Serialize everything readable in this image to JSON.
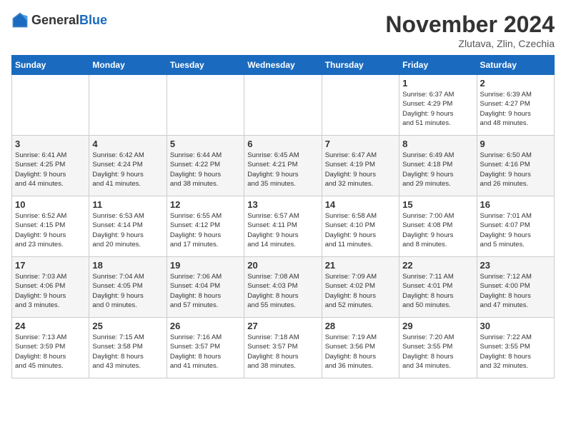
{
  "logo": {
    "general": "General",
    "blue": "Blue"
  },
  "title": "November 2024",
  "subtitle": "Zlutava, Zlin, Czechia",
  "days_of_week": [
    "Sunday",
    "Monday",
    "Tuesday",
    "Wednesday",
    "Thursday",
    "Friday",
    "Saturday"
  ],
  "weeks": [
    [
      {
        "day": "",
        "info": ""
      },
      {
        "day": "",
        "info": ""
      },
      {
        "day": "",
        "info": ""
      },
      {
        "day": "",
        "info": ""
      },
      {
        "day": "",
        "info": ""
      },
      {
        "day": "1",
        "info": "Sunrise: 6:37 AM\nSunset: 4:29 PM\nDaylight: 9 hours\nand 51 minutes."
      },
      {
        "day": "2",
        "info": "Sunrise: 6:39 AM\nSunset: 4:27 PM\nDaylight: 9 hours\nand 48 minutes."
      }
    ],
    [
      {
        "day": "3",
        "info": "Sunrise: 6:41 AM\nSunset: 4:25 PM\nDaylight: 9 hours\nand 44 minutes."
      },
      {
        "day": "4",
        "info": "Sunrise: 6:42 AM\nSunset: 4:24 PM\nDaylight: 9 hours\nand 41 minutes."
      },
      {
        "day": "5",
        "info": "Sunrise: 6:44 AM\nSunset: 4:22 PM\nDaylight: 9 hours\nand 38 minutes."
      },
      {
        "day": "6",
        "info": "Sunrise: 6:45 AM\nSunset: 4:21 PM\nDaylight: 9 hours\nand 35 minutes."
      },
      {
        "day": "7",
        "info": "Sunrise: 6:47 AM\nSunset: 4:19 PM\nDaylight: 9 hours\nand 32 minutes."
      },
      {
        "day": "8",
        "info": "Sunrise: 6:49 AM\nSunset: 4:18 PM\nDaylight: 9 hours\nand 29 minutes."
      },
      {
        "day": "9",
        "info": "Sunrise: 6:50 AM\nSunset: 4:16 PM\nDaylight: 9 hours\nand 26 minutes."
      }
    ],
    [
      {
        "day": "10",
        "info": "Sunrise: 6:52 AM\nSunset: 4:15 PM\nDaylight: 9 hours\nand 23 minutes."
      },
      {
        "day": "11",
        "info": "Sunrise: 6:53 AM\nSunset: 4:14 PM\nDaylight: 9 hours\nand 20 minutes."
      },
      {
        "day": "12",
        "info": "Sunrise: 6:55 AM\nSunset: 4:12 PM\nDaylight: 9 hours\nand 17 minutes."
      },
      {
        "day": "13",
        "info": "Sunrise: 6:57 AM\nSunset: 4:11 PM\nDaylight: 9 hours\nand 14 minutes."
      },
      {
        "day": "14",
        "info": "Sunrise: 6:58 AM\nSunset: 4:10 PM\nDaylight: 9 hours\nand 11 minutes."
      },
      {
        "day": "15",
        "info": "Sunrise: 7:00 AM\nSunset: 4:08 PM\nDaylight: 9 hours\nand 8 minutes."
      },
      {
        "day": "16",
        "info": "Sunrise: 7:01 AM\nSunset: 4:07 PM\nDaylight: 9 hours\nand 5 minutes."
      }
    ],
    [
      {
        "day": "17",
        "info": "Sunrise: 7:03 AM\nSunset: 4:06 PM\nDaylight: 9 hours\nand 3 minutes."
      },
      {
        "day": "18",
        "info": "Sunrise: 7:04 AM\nSunset: 4:05 PM\nDaylight: 9 hours\nand 0 minutes."
      },
      {
        "day": "19",
        "info": "Sunrise: 7:06 AM\nSunset: 4:04 PM\nDaylight: 8 hours\nand 57 minutes."
      },
      {
        "day": "20",
        "info": "Sunrise: 7:08 AM\nSunset: 4:03 PM\nDaylight: 8 hours\nand 55 minutes."
      },
      {
        "day": "21",
        "info": "Sunrise: 7:09 AM\nSunset: 4:02 PM\nDaylight: 8 hours\nand 52 minutes."
      },
      {
        "day": "22",
        "info": "Sunrise: 7:11 AM\nSunset: 4:01 PM\nDaylight: 8 hours\nand 50 minutes."
      },
      {
        "day": "23",
        "info": "Sunrise: 7:12 AM\nSunset: 4:00 PM\nDaylight: 8 hours\nand 47 minutes."
      }
    ],
    [
      {
        "day": "24",
        "info": "Sunrise: 7:13 AM\nSunset: 3:59 PM\nDaylight: 8 hours\nand 45 minutes."
      },
      {
        "day": "25",
        "info": "Sunrise: 7:15 AM\nSunset: 3:58 PM\nDaylight: 8 hours\nand 43 minutes."
      },
      {
        "day": "26",
        "info": "Sunrise: 7:16 AM\nSunset: 3:57 PM\nDaylight: 8 hours\nand 41 minutes."
      },
      {
        "day": "27",
        "info": "Sunrise: 7:18 AM\nSunset: 3:57 PM\nDaylight: 8 hours\nand 38 minutes."
      },
      {
        "day": "28",
        "info": "Sunrise: 7:19 AM\nSunset: 3:56 PM\nDaylight: 8 hours\nand 36 minutes."
      },
      {
        "day": "29",
        "info": "Sunrise: 7:20 AM\nSunset: 3:55 PM\nDaylight: 8 hours\nand 34 minutes."
      },
      {
        "day": "30",
        "info": "Sunrise: 7:22 AM\nSunset: 3:55 PM\nDaylight: 8 hours\nand 32 minutes."
      }
    ]
  ]
}
